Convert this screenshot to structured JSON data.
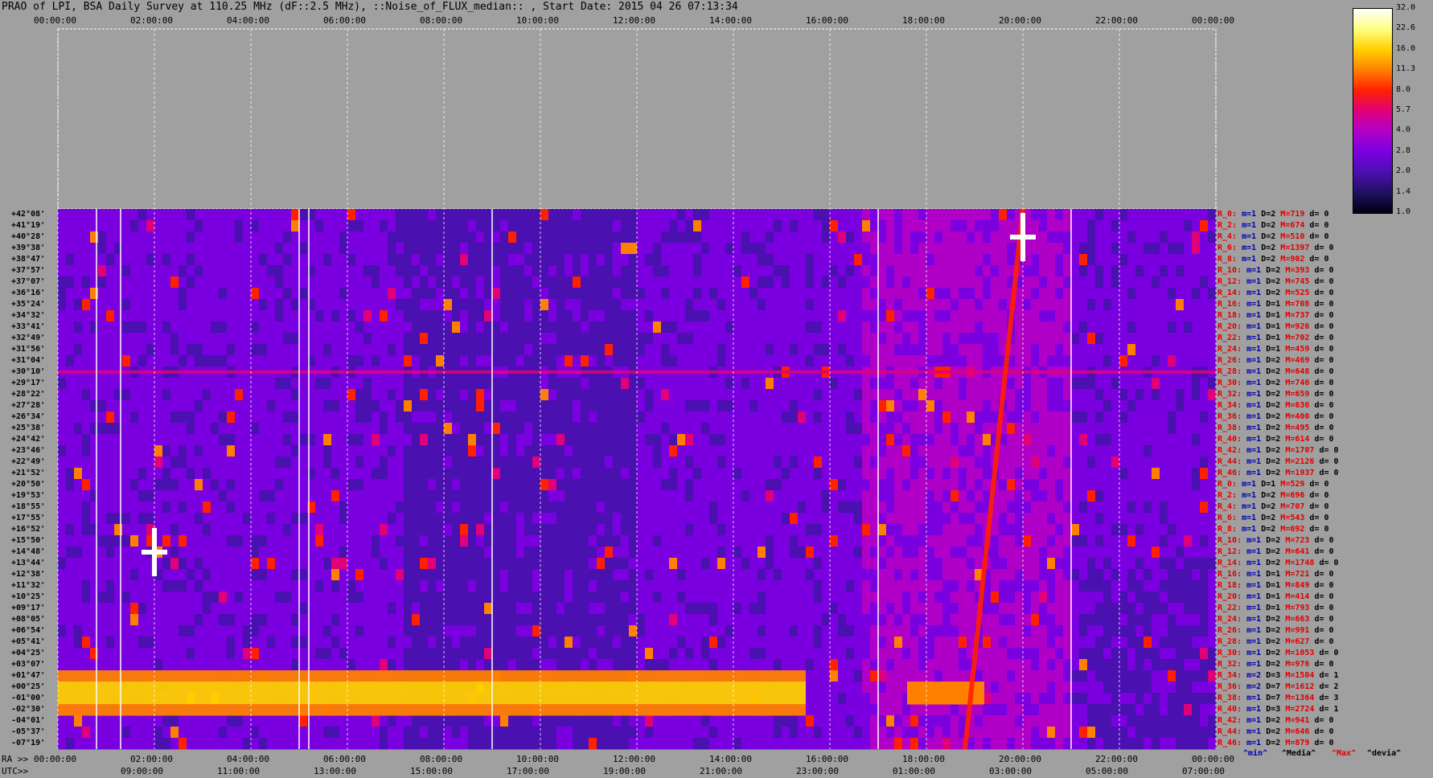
{
  "title": "PRAO of LPI, BSA Daily Survey at 110.25 MHz (dF::2.5 MHz), ::Noise_of_FLUX_median:: , Start Date: 2015 04 26 07:13:34",
  "top_time_labels": [
    "00:00:00",
    "02:00:00",
    "04:00:00",
    "06:00:00",
    "08:00:00",
    "10:00:00",
    "12:00:00",
    "14:00:00",
    "16:00:00",
    "18:00:00",
    "20:00:00",
    "22:00:00",
    "00:00:00"
  ],
  "ra_prefix": "RA >>",
  "ra_labels": [
    "00:00:00",
    "02:00:00",
    "04:00:00",
    "06:00:00",
    "08:00:00",
    "10:00:00",
    "12:00:00",
    "14:00:00",
    "16:00:00",
    "18:00:00",
    "20:00:00",
    "22:00:00",
    "00:00:00"
  ],
  "utc_prefix": "UTC>>",
  "utc_labels": [
    "09:00:00",
    "11:00:00",
    "13:00:00",
    "15:00:00",
    "17:00:00",
    "19:00:00",
    "21:00:00",
    "23:00:00",
    "01:00:00",
    "03:00:00",
    "05:00:00",
    "07:00:00"
  ],
  "colorbar": {
    "ticks": [
      "32.0",
      "22.6",
      "16.0",
      "11.3",
      "8.0",
      "5.7",
      "4.0",
      "2.8",
      "2.0",
      "1.4",
      "1.0"
    ],
    "colors": [
      "#ffffff",
      "#ffff80",
      "#ffd000",
      "#ff8000",
      "#ff2000",
      "#e0007a",
      "#b000c8",
      "#7a00e0",
      "#4a10b0",
      "#201060",
      "#000010"
    ]
  },
  "declinations": [
    "+42°08'",
    "+41°19'",
    "+40°28'",
    "+39°38'",
    "+38°47'",
    "+37°57'",
    "+37°07'",
    "+36°16'",
    "+35°24'",
    "+34°32'",
    "+33°41'",
    "+32°49'",
    "+31°56'",
    "+31°04'",
    "+30°10'",
    "+29°17'",
    "+28°22'",
    "+27°28'",
    "+26°34'",
    "+25°38'",
    "+24°42'",
    "+23°46'",
    "+22°49'",
    "+21°52'",
    "+20°50'",
    "+19°53'",
    "+18°55'",
    "+17°55'",
    "+16°52'",
    "+15°50'",
    "+14°48'",
    "+13°44'",
    "+12°38'",
    "+11°32'",
    "+10°25'",
    "+09°17'",
    "+08°05'",
    "+06°54'",
    "+05°41'",
    "+04°25'",
    "+03°07'",
    "+01°47'",
    "+00°25'",
    "-01°00'",
    "-02°30'",
    "-04°01'",
    "-05°37'",
    "-07°19'"
  ],
  "row_stats": [
    {
      "name": "R_0:",
      "m": "m=1",
      "d": "D=2",
      "M": "M=719",
      "dev": "d= 0"
    },
    {
      "name": "R_2:",
      "m": "m=1",
      "d": "D=2",
      "M": "M=674",
      "dev": "d= 0"
    },
    {
      "name": "R_4:",
      "m": "m=1",
      "d": "D=2",
      "M": "M=510",
      "dev": "d= 0"
    },
    {
      "name": "R_6:",
      "m": "m=1",
      "d": "D=2",
      "M": "M=1397",
      "dev": "d= 0"
    },
    {
      "name": "R_8:",
      "m": "m=1",
      "d": "D=2",
      "M": "M=902",
      "dev": "d= 0"
    },
    {
      "name": "R_10:",
      "m": "m=1",
      "d": "D=2",
      "M": "M=393",
      "dev": "d= 0"
    },
    {
      "name": "R_12:",
      "m": "m=1",
      "d": "D=2",
      "M": "M=745",
      "dev": "d= 0"
    },
    {
      "name": "R_14:",
      "m": "m=1",
      "d": "D=2",
      "M": "M=525",
      "dev": "d= 0"
    },
    {
      "name": "R_16:",
      "m": "m=1",
      "d": "D=1",
      "M": "M=708",
      "dev": "d= 0"
    },
    {
      "name": "R_18:",
      "m": "m=1",
      "d": "D=1",
      "M": "M=737",
      "dev": "d= 0"
    },
    {
      "name": "R_20:",
      "m": "m=1",
      "d": "D=1",
      "M": "M=926",
      "dev": "d= 0"
    },
    {
      "name": "R_22:",
      "m": "m=1",
      "d": "D=1",
      "M": "M=702",
      "dev": "d= 0"
    },
    {
      "name": "R_24:",
      "m": "m=1",
      "d": "D=1",
      "M": "M=459",
      "dev": "d= 0"
    },
    {
      "name": "R_26:",
      "m": "m=1",
      "d": "D=2",
      "M": "M=469",
      "dev": "d= 0"
    },
    {
      "name": "R_28:",
      "m": "m=1",
      "d": "D=2",
      "M": "M=648",
      "dev": "d= 0"
    },
    {
      "name": "R_30:",
      "m": "m=1",
      "d": "D=2",
      "M": "M=746",
      "dev": "d= 0"
    },
    {
      "name": "R_32:",
      "m": "m=1",
      "d": "D=2",
      "M": "M=659",
      "dev": "d= 0"
    },
    {
      "name": "R_34:",
      "m": "m=1",
      "d": "D=2",
      "M": "M=636",
      "dev": "d= 0"
    },
    {
      "name": "R_36:",
      "m": "m=1",
      "d": "D=2",
      "M": "M=400",
      "dev": "d= 0"
    },
    {
      "name": "R_38:",
      "m": "m=1",
      "d": "D=2",
      "M": "M=495",
      "dev": "d= 0"
    },
    {
      "name": "R_40:",
      "m": "m=1",
      "d": "D=2",
      "M": "M=614",
      "dev": "d= 0"
    },
    {
      "name": "R_42:",
      "m": "m=1",
      "d": "D=2",
      "M": "M=1707",
      "dev": "d= 0"
    },
    {
      "name": "R_44:",
      "m": "m=1",
      "d": "D=2",
      "M": "M=2126",
      "dev": "d= 0"
    },
    {
      "name": "R_46:",
      "m": "m=1",
      "d": "D=2",
      "M": "M=1937",
      "dev": "d= 0"
    },
    {
      "name": "R_0:",
      "m": "m=1",
      "d": "D=1",
      "M": "M=529",
      "dev": "d= 0"
    },
    {
      "name": "R_2:",
      "m": "m=1",
      "d": "D=2",
      "M": "M=696",
      "dev": "d= 0"
    },
    {
      "name": "R_4:",
      "m": "m=1",
      "d": "D=2",
      "M": "M=707",
      "dev": "d= 0"
    },
    {
      "name": "R_6:",
      "m": "m=1",
      "d": "D=2",
      "M": "M=543",
      "dev": "d= 0"
    },
    {
      "name": "R_8:",
      "m": "m=1",
      "d": "D=2",
      "M": "M=692",
      "dev": "d= 0"
    },
    {
      "name": "R_10:",
      "m": "m=1",
      "d": "D=2",
      "M": "M=723",
      "dev": "d= 0"
    },
    {
      "name": "R_12:",
      "m": "m=1",
      "d": "D=2",
      "M": "M=641",
      "dev": "d= 0"
    },
    {
      "name": "R_14:",
      "m": "m=1",
      "d": "D=2",
      "M": "M=1748",
      "dev": "d= 0"
    },
    {
      "name": "R_16:",
      "m": "m=1",
      "d": "D=1",
      "M": "M=721",
      "dev": "d= 0"
    },
    {
      "name": "R_18:",
      "m": "m=1",
      "d": "D=1",
      "M": "M=849",
      "dev": "d= 0"
    },
    {
      "name": "R_20:",
      "m": "m=1",
      "d": "D=1",
      "M": "M=414",
      "dev": "d= 0"
    },
    {
      "name": "R_22:",
      "m": "m=1",
      "d": "D=1",
      "M": "M=793",
      "dev": "d= 0"
    },
    {
      "name": "R_24:",
      "m": "m=1",
      "d": "D=2",
      "M": "M=663",
      "dev": "d= 0"
    },
    {
      "name": "R_26:",
      "m": "m=1",
      "d": "D=2",
      "M": "M=991",
      "dev": "d= 0"
    },
    {
      "name": "R_28:",
      "m": "m=1",
      "d": "D=2",
      "M": "M=627",
      "dev": "d= 0"
    },
    {
      "name": "R_30:",
      "m": "m=1",
      "d": "D=2",
      "M": "M=1053",
      "dev": "d= 0"
    },
    {
      "name": "R_32:",
      "m": "m=1",
      "d": "D=2",
      "M": "M=976",
      "dev": "d= 0"
    },
    {
      "name": "R_34:",
      "m": "m=2",
      "d": "D=3",
      "M": "M=1504",
      "dev": "d= 1"
    },
    {
      "name": "R_36:",
      "m": "m=2",
      "d": "D=7",
      "M": "M=1612",
      "dev": "d= 2"
    },
    {
      "name": "R_38:",
      "m": "m=1",
      "d": "D=7",
      "M": "M=1364",
      "dev": "d= 3"
    },
    {
      "name": "R_40:",
      "m": "m=1",
      "d": "D=3",
      "M": "M=2724",
      "dev": "d= 1"
    },
    {
      "name": "R_42:",
      "m": "m=1",
      "d": "D=2",
      "M": "M=941",
      "dev": "d= 0"
    },
    {
      "name": "R_44:",
      "m": "m=1",
      "d": "D=2",
      "M": "M=646",
      "dev": "d= 0"
    },
    {
      "name": "R_46:",
      "m": "m=1",
      "d": "D=2",
      "M": "M=879",
      "dev": "d= 0"
    }
  ],
  "legend": {
    "min": "^min^",
    "median": "^Media^",
    "max": "^Max^",
    "dev": "^devia^"
  },
  "chart_data": {
    "type": "heatmap",
    "title": "PRAO of LPI, BSA Daily Survey at 110.25 MHz (dF::2.5 MHz), ::Noise_of_FLUX_median:: , Start Date: 2015 04 26 07:13:34",
    "x_axis_top": "sidereal time 00:00:00 – 00:00:00 (2 h ticks)",
    "x_axis_bottom": [
      "RA >> 00:00:00 … 00:00:00",
      "UTC>> 09:00:00 … 07:00:00"
    ],
    "y_axis": "declination rows +42°08' to -07°19' (48 rows)",
    "color_scale": [
      1.0,
      1.4,
      2.0,
      2.8,
      4.0,
      5.7,
      8.0,
      11.3,
      16.0,
      22.6,
      32.0
    ],
    "features": [
      {
        "kind": "bright horizontal band",
        "rows": "+01°47' to -02°30'",
        "ra_hours": [
          0,
          15.5
        ],
        "level": "16-32"
      },
      {
        "kind": "bright horizontal band",
        "rows": "+00°25' to -01°00'",
        "ra_hours": [
          18,
          19.5
        ],
        "level": "8-11"
      },
      {
        "kind": "point source",
        "ra_hours": 2.0,
        "dec": "+14°48'",
        "level": "32"
      },
      {
        "kind": "point source",
        "ra_hours": 20.0,
        "dec": "+40°28'",
        "level": "32"
      },
      {
        "kind": "diagonal track",
        "ra_start": 18.8,
        "ra_end": 20.0,
        "dec_start": "-07°19'",
        "dec_end": "+42°08'",
        "level": "8-16"
      },
      {
        "kind": "horizontal line",
        "dec": "+30°10'",
        "level": "5.7"
      }
    ]
  }
}
